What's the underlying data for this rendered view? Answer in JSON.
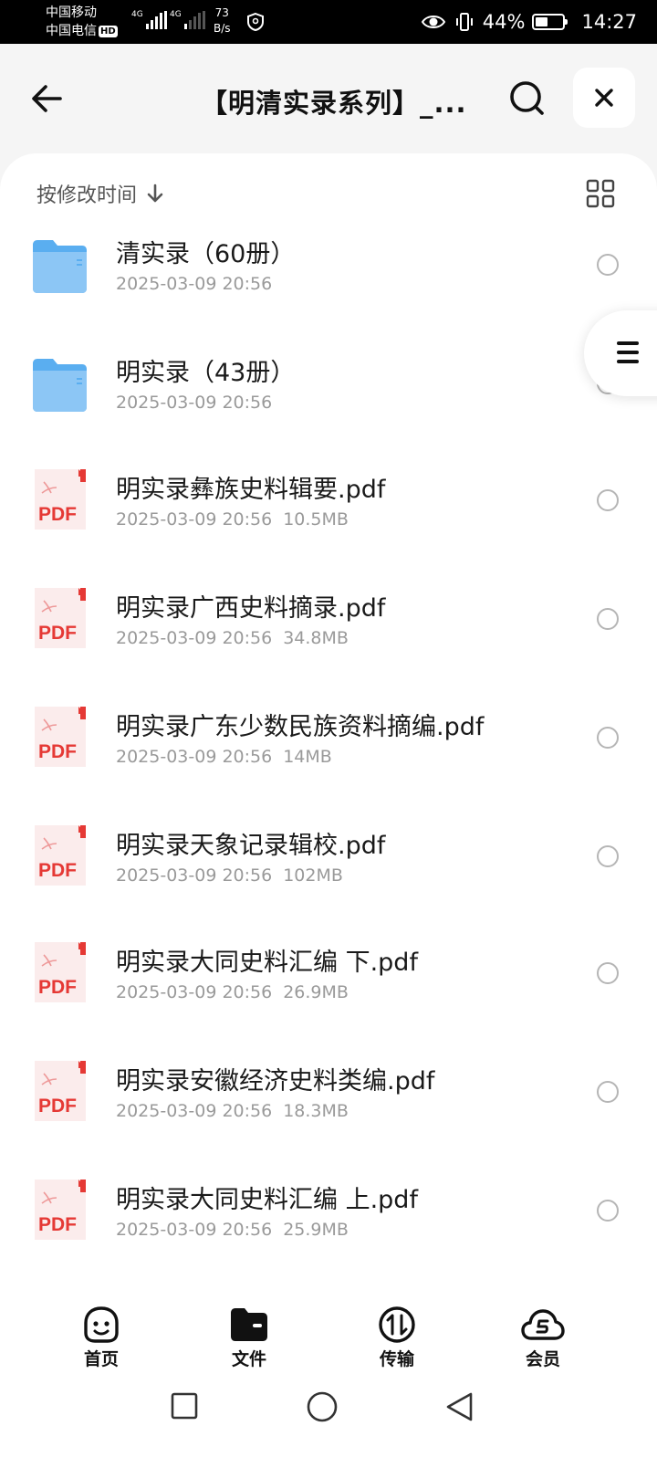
{
  "status_bar": {
    "carrier_1": "中国移动",
    "carrier_2": "中国电信",
    "hd": "HD",
    "net_1": "4G",
    "net_2": "4G",
    "speed_value": "73",
    "speed_unit": "B/s",
    "battery": "44%",
    "battery_level": 0.44,
    "time": "14:27"
  },
  "header": {
    "title": "【明清实录系列】_..."
  },
  "toolbar": {
    "sort_label": "按修改时间"
  },
  "files": [
    {
      "type": "folder",
      "name": "清实录（60册）",
      "date": "2025-03-09 20:56",
      "size": ""
    },
    {
      "type": "folder",
      "name": "明实录（43册）",
      "date": "2025-03-09 20:56",
      "size": ""
    },
    {
      "type": "pdf",
      "name": "明实录彝族史料辑要.pdf",
      "date": "2025-03-09 20:56",
      "size": "10.5MB"
    },
    {
      "type": "pdf",
      "name": "明实录广西史料摘录.pdf",
      "date": "2025-03-09 20:56",
      "size": "34.8MB"
    },
    {
      "type": "pdf",
      "name": "明实录广东少数民族资料摘编.pdf",
      "date": "2025-03-09 20:56",
      "size": "14MB"
    },
    {
      "type": "pdf",
      "name": "明实录天象记录辑校.pdf",
      "date": "2025-03-09 20:56",
      "size": "102MB"
    },
    {
      "type": "pdf",
      "name": "明实录大同史料汇编 下.pdf",
      "date": "2025-03-09 20:56",
      "size": "26.9MB"
    },
    {
      "type": "pdf",
      "name": "明实录安徽经济史料类编.pdf",
      "date": "2025-03-09 20:56",
      "size": "18.3MB"
    },
    {
      "type": "pdf",
      "name": "明实录大同史料汇编 上.pdf",
      "date": "2025-03-09 20:56",
      "size": "25.9MB"
    }
  ],
  "pdf_badge": "PDF",
  "tabs": [
    {
      "label": "首页",
      "icon": "smiley-icon"
    },
    {
      "label": "文件",
      "icon": "folder-icon"
    },
    {
      "label": "传输",
      "icon": "transfer-icon"
    },
    {
      "label": "会员",
      "icon": "cloud-icon"
    }
  ],
  "colors": {
    "folder": "#5aaef0",
    "pdf_red": "#e53935",
    "text": "#1a1a1a",
    "meta": "#9a9a9a"
  }
}
